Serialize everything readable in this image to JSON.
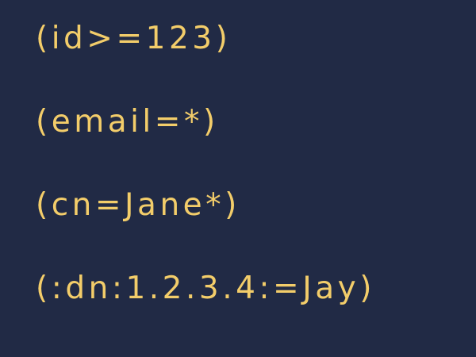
{
  "filters": [
    "(id>=123)",
    "(email=*)",
    "(cn=Jane*)",
    "(:dn:1.2.3.4:=Jay)"
  ],
  "colors": {
    "background": "#212a45",
    "text": "#f3cd6a"
  }
}
